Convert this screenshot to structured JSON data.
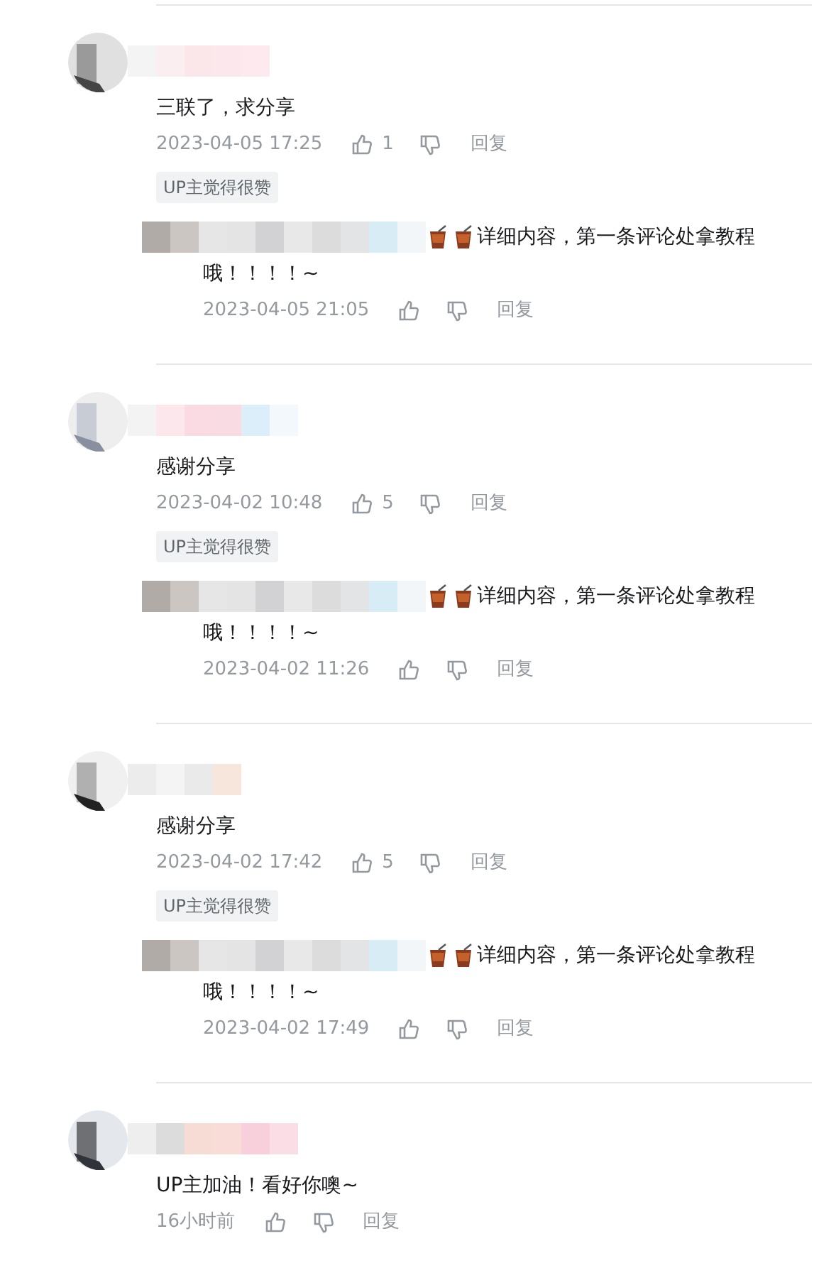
{
  "comments": [
    {
      "text": "三联了，求分享",
      "time": "2023-04-05 17:25",
      "like_count": "1",
      "reply_label": "回复",
      "badge": "UP主觉得很赞",
      "replies": [
        {
          "content_lines": [
            "详细内容，第一条评论处拿教程",
            "哦！！！！~"
          ],
          "time": "2023-04-05 21:05",
          "reply_label": "回复"
        }
      ]
    },
    {
      "text": "感谢分享",
      "time": "2023-04-02 10:48",
      "like_count": "5",
      "reply_label": "回复",
      "badge": "UP主觉得很赞",
      "replies": [
        {
          "content_lines": [
            "详细内容，第一条评论处拿教程",
            "哦！！！！~"
          ],
          "time": "2023-04-02 11:26",
          "reply_label": "回复"
        }
      ]
    },
    {
      "text": "感谢分享",
      "time": "2023-04-02 17:42",
      "like_count": "5",
      "reply_label": "回复",
      "badge": "UP主觉得很赞",
      "replies": [
        {
          "content_lines": [
            "详细内容，第一条评论处拿教程",
            "哦！！！！~"
          ],
          "time": "2023-04-02 17:49",
          "reply_label": "回复"
        }
      ]
    },
    {
      "text": "UP主加油！看好你噢~",
      "time": "16小时前",
      "reply_label": "回复"
    }
  ]
}
